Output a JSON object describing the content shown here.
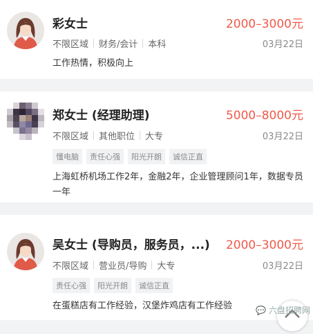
{
  "listings": [
    {
      "name": "彩女士",
      "salary": "2000–3000元",
      "area": "不限区域",
      "position": "财务/会计",
      "education": "本科",
      "date": "03月22日",
      "tags": [],
      "description": "工作热情，积极向上"
    },
    {
      "name": "郑女士 (经理助理)",
      "salary": "5000–8000元",
      "area": "不限区域",
      "position": "其他职位",
      "education": "大专",
      "date": "03月22日",
      "tags": [
        "懂电脑",
        "责任心强",
        "阳光开朗",
        "诚信正直"
      ],
      "description": "上海虹桥机场工作2年，金融2年，企业管理顾问1年，数据专员一年"
    },
    {
      "name": "吴女士 (导购员，服务员，...)",
      "salary": "2000–3000元",
      "area": "不限区域",
      "position": "营业员/导购",
      "education": "大专",
      "date": "03月22日",
      "tags": [
        "责任心强",
        "阳光开朗",
        "诚信正直"
      ],
      "description": "在蛋糕店有工作经验，汉堡炸鸡店有工作经验"
    }
  ],
  "watermark": "六盘招聘网",
  "icons": {
    "avatar": "female-avatar-icon",
    "avatar_blurred": "pixelated-avatar-icon",
    "scroll_top": "chevron-up-icon",
    "watermark": "chat-bubble-icon"
  },
  "colors": {
    "salary": "#f05a4a",
    "background": "#f2f3f5"
  }
}
